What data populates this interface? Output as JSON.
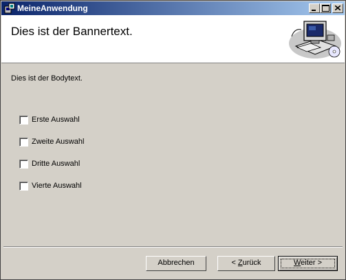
{
  "window": {
    "title": "MeineAnwendung",
    "icon": "installer-icon",
    "controls": [
      "minimize-icon",
      "maximize-icon",
      "close-icon"
    ]
  },
  "banner": {
    "text": "Dies ist der Bannertext.",
    "graphic": "computer-icon"
  },
  "body": {
    "text": "Dies ist der Bodytext."
  },
  "options": [
    {
      "label": "Erste Auswahl",
      "checked": false
    },
    {
      "label": "Zweite Auswahl",
      "checked": false
    },
    {
      "label": "Dritte Auswahl",
      "checked": false
    },
    {
      "label": "Vierte Auswahl",
      "checked": false
    }
  ],
  "buttons": {
    "cancel": "Abbrechen",
    "back_prefix": "< ",
    "back_accel": "Z",
    "back_rest": "urück",
    "next_accel": "W",
    "next_rest": "eiter >"
  },
  "colors": {
    "titlebar_start": "#0a246a",
    "titlebar_end": "#a6caf0",
    "face": "#d4d0c8"
  }
}
